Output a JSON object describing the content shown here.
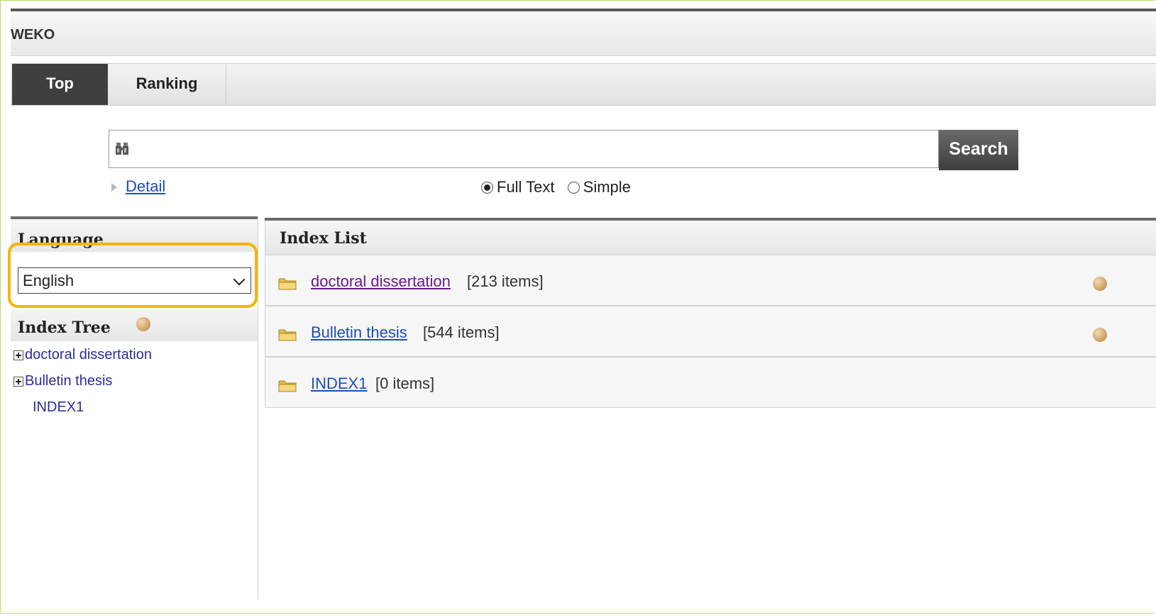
{
  "app": {
    "title": "WEKO"
  },
  "tabs": [
    {
      "label": "Top",
      "active": true
    },
    {
      "label": "Ranking",
      "active": false
    }
  ],
  "search": {
    "value": "",
    "button_label": "Search",
    "detail_label": "Detail",
    "modes": [
      {
        "label": "Full Text",
        "selected": true
      },
      {
        "label": "Simple",
        "selected": false
      }
    ]
  },
  "sidebar": {
    "language_heading": "Language",
    "language_selected": "English",
    "tree_heading": "Index Tree",
    "tree_items": [
      {
        "label": "doctoral dissertation",
        "expandable": true
      },
      {
        "label": "Bulletin thesis",
        "expandable": true
      },
      {
        "label": "INDEX1",
        "expandable": false
      }
    ]
  },
  "index_list": {
    "heading": "Index List",
    "rows": [
      {
        "name": "doctoral dissertation",
        "count": "[213 items]",
        "visited": true,
        "help": true
      },
      {
        "name": "Bulletin thesis",
        "count": "[544 items]",
        "visited": false,
        "help": true
      },
      {
        "name": "INDEX1",
        "count": "[0 items]",
        "visited": false,
        "help": false
      }
    ]
  },
  "colors": {
    "highlight": "#f5b400",
    "link": "#1a4fb5",
    "visited_link": "#6b1b8e",
    "tree_link": "#2b2d96",
    "active_tab": "#3f3f3f"
  }
}
